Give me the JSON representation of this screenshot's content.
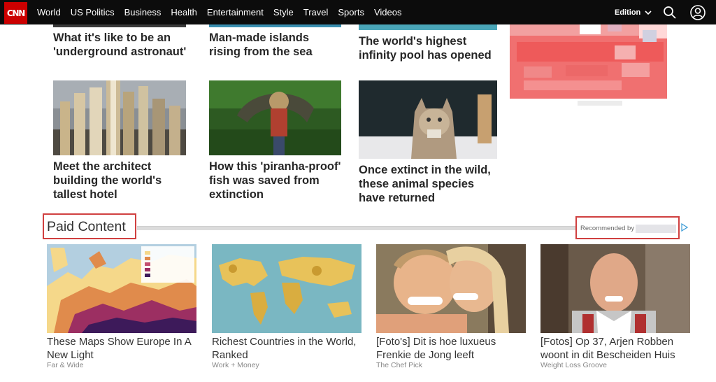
{
  "nav": {
    "logo": "CNN",
    "links": [
      "World",
      "US Politics",
      "Business",
      "Health",
      "Entertainment",
      "Style",
      "Travel",
      "Sports",
      "Videos"
    ],
    "edition": "Edition",
    "icons": [
      "search-icon",
      "account-icon",
      "chevron-down-icon"
    ]
  },
  "stories": {
    "row1": [
      "What it's like to be an 'underground astronaut'",
      "Man-made islands rising from the sea",
      "The world's highest infinity pool has opened"
    ],
    "row2": [
      "Meet the architect building the world's tallest hotel",
      "How this 'piranha-proof' fish was saved from extinction",
      "Once extinct in the wild, these animal species have returned"
    ]
  },
  "paid": {
    "heading": "Paid Content",
    "recommended_by": "Recommended by",
    "items": [
      {
        "title": "These Maps Show Europe In A New Light",
        "source": "Far & Wide"
      },
      {
        "title": "Richest Countries in the World, Ranked",
        "source": "Work + Money"
      },
      {
        "title": "[Foto's] Dit is hoe luxueus Frenkie de Jong leeft",
        "source": "The Chef Pick"
      },
      {
        "title": "[Fotos] Op 37, Arjen Robben woont in dit Bescheiden Huis",
        "source": "Weight Loss Groove"
      }
    ]
  },
  "colors": {
    "brand": "#cc0000",
    "nav_bg": "#0c0c0c",
    "highlight_box": "#d04040"
  }
}
